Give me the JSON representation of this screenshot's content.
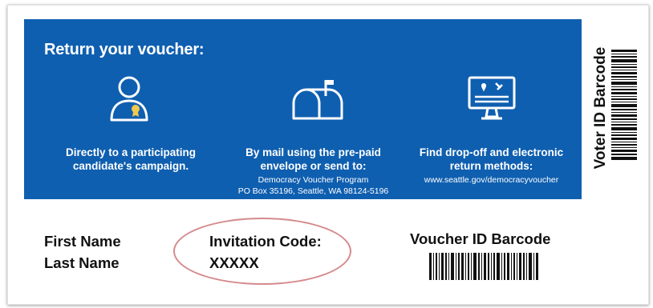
{
  "panel": {
    "background": "#0f5fb0",
    "title": "Return your voucher:",
    "options": [
      {
        "icon": "person-with-badge-icon",
        "main": "Directly to a participating candidate's campaign.",
        "sub": []
      },
      {
        "icon": "mailbox-icon",
        "main": "By mail using the pre-paid envelope or send to:",
        "sub": [
          "Democracy Voucher Program",
          "PO Box 35196, Seattle, WA 98124-5196"
        ]
      },
      {
        "icon": "computer-monitor-icon",
        "main": "Find drop-off and electronic return methods:",
        "sub": [
          "www.seattle.gov/democracyvoucher"
        ]
      }
    ]
  },
  "voter_id": {
    "label": "Voter ID Barcode"
  },
  "recipient": {
    "first_name": "First Name",
    "last_name": "Last Name"
  },
  "invitation": {
    "label": "Invitation Code:",
    "code": "XXXXX",
    "highlight_color": "#d58a8c"
  },
  "voucher_id": {
    "label": "Voucher ID Barcode"
  }
}
